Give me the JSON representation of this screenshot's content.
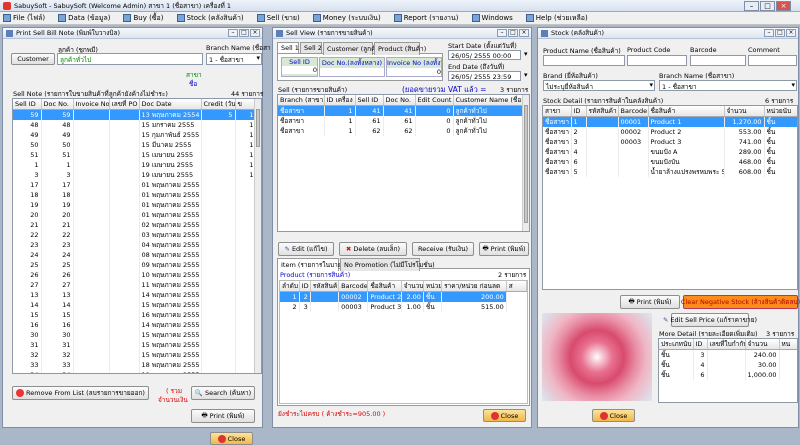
{
  "app": {
    "title": "SabuySoft - SabuySoft (Welcome Admin) สาขา 1 (ชื่อสาขา) เครื่องที่ 1"
  },
  "menu": [
    "File (ไฟล์)",
    "Data (ข้อมูล)",
    "Buy (ซื้อ)",
    "Stock (คลังสินค้า)",
    "Sell (ขาย)",
    "Money (ระบบเงิน)",
    "Report (รายงาน)",
    "Windows",
    "Help (ช่วยเหลือ)"
  ],
  "bill": {
    "title": "Print Sell Bill Note (พิมพ์ใบวางบิล)",
    "customer_code_label": "ลูกค้า (ชูกพมี)",
    "customer_button": "Customer",
    "customer_value": "ลูกค้าทั่วไป",
    "branch_label": "Branch Name (ชื่อสา",
    "branch_value": "1 - ชื่อสาขา",
    "side1": "สาขา",
    "side2": "ชื่อ",
    "list_title": "Sell Note (รายการใบขายสินค้าที่ลูกค้ายังค้างไม่ชำระ)",
    "count": "44 รายการ",
    "cols": [
      "Sell ID",
      "Doc No.",
      "Invoice No.",
      "เลขที่ PO",
      "Doc Date",
      "Credit (วัน)",
      "ข"
    ],
    "rows": [
      [
        "59",
        "59",
        "",
        "",
        "13 พฤษภาคม 2554",
        "5",
        "1"
      ],
      [
        "48",
        "48",
        "",
        "",
        "15 มกราคม 2555",
        "",
        "1"
      ],
      [
        "49",
        "49",
        "",
        "",
        "15 กุมภาพันธ์ 2555",
        "",
        "1"
      ],
      [
        "50",
        "50",
        "",
        "",
        "15 มีนาคม 2555",
        "",
        "1"
      ],
      [
        "51",
        "51",
        "",
        "",
        "15 เมษายน 2555",
        "",
        "1"
      ],
      [
        "1",
        "1",
        "",
        "",
        "19 เมษายน 2555",
        "",
        "1"
      ],
      [
        "3",
        "3",
        "",
        "",
        "19 เมษายน 2555",
        "",
        "1"
      ],
      [
        "17",
        "17",
        "",
        "",
        "01 พฤษภาคม 2555",
        "",
        ""
      ],
      [
        "18",
        "18",
        "",
        "",
        "01 พฤษภาคม 2555",
        "",
        ""
      ],
      [
        "19",
        "19",
        "",
        "",
        "01 พฤษภาคม 2555",
        "",
        ""
      ],
      [
        "20",
        "20",
        "",
        "",
        "01 พฤษภาคม 2555",
        "",
        ""
      ],
      [
        "21",
        "21",
        "",
        "",
        "02 พฤษภาคม 2555",
        "",
        ""
      ],
      [
        "22",
        "22",
        "",
        "",
        "03 พฤษภาคม 2555",
        "",
        ""
      ],
      [
        "23",
        "23",
        "",
        "",
        "04 พฤษภาคม 2555",
        "",
        ""
      ],
      [
        "24",
        "24",
        "",
        "",
        "08 พฤษภาคม 2555",
        "",
        ""
      ],
      [
        "25",
        "25",
        "",
        "",
        "09 พฤษภาคม 2555",
        "",
        ""
      ],
      [
        "26",
        "26",
        "",
        "",
        "10 พฤษภาคม 2555",
        "",
        ""
      ],
      [
        "27",
        "27",
        "",
        "",
        "11 พฤษภาคม 2555",
        "",
        ""
      ],
      [
        "13",
        "13",
        "",
        "",
        "14 พฤษภาคม 2555",
        "",
        ""
      ],
      [
        "14",
        "14",
        "",
        "",
        "15 พฤษภาคม 2555",
        "",
        ""
      ],
      [
        "15",
        "15",
        "",
        "",
        "16 พฤษภาคม 2555",
        "",
        ""
      ],
      [
        "16",
        "16",
        "",
        "",
        "14 พฤษภาคม 2555",
        "",
        ""
      ],
      [
        "30",
        "30",
        "",
        "",
        "15 พฤษภาคม 2555",
        "",
        ""
      ],
      [
        "31",
        "31",
        "",
        "",
        "15 พฤษภาคม 2555",
        "",
        ""
      ],
      [
        "32",
        "32",
        "",
        "",
        "15 พฤษภาคม 2555",
        "",
        ""
      ],
      [
        "33",
        "33",
        "",
        "",
        "18 พฤษภาคม 2555",
        "",
        ""
      ],
      [
        "34",
        "34",
        "",
        "",
        "19 พฤษภาคม 2555",
        "",
        ""
      ]
    ],
    "remove_button": "Remove From List (ลบรายการขายออก)",
    "total_label1": "( รวม",
    "total_label2": "จำนวนเงิน",
    "search_button": "Search (ค้นหา)",
    "print_button": "Print (พิมพ์)",
    "close_button": "Close"
  },
  "sell": {
    "title": "Sell View (รายการขายสินค้า)",
    "tabs": [
      "Sell 1",
      "Sell 2",
      "Customer (ลูกค้า)",
      "Product (สินค้า)"
    ],
    "cols_a": [
      "Sell ID",
      "Doc No.(ลงทั้งหลาง)",
      "Invoice No (ลงทั้งห"
    ],
    "vals_a": [
      "0",
      "",
      "0"
    ],
    "start_label": "Start Date (ตั้งแต่วันที่)",
    "start_value": "26/05/ 2555 00:00",
    "end_label": "End Date (ถึงวันที่)",
    "end_value": "26/05/ 2555 23:59",
    "list_title": "Sell (รายการขายสินค้า)",
    "vat": "(ยอดขายรวม VAT แล้ว =",
    "count": "3 รายการ",
    "cols": [
      "Branch (สาขา)",
      "ID เครื่อง",
      "Sell ID",
      "Doc No.",
      "Edit Count",
      "Customer Name (ชื่อลูกค้"
    ],
    "rows": [
      [
        "ชื่อสาขา",
        "1",
        "41",
        "41",
        "0",
        "ลูกค้าทั่วไป"
      ],
      [
        "ชื่อสาขา",
        "1",
        "61",
        "61",
        "0",
        "ลูกค้าทั่วไป"
      ],
      [
        "ชื่อสาขา",
        "1",
        "62",
        "62",
        "0",
        "ลูกค้าทั่วไป"
      ]
    ],
    "edit_button": "Edit (แก้ไข)",
    "delete_button": "Delete (ลบเล็ก)",
    "receive_button": "Receive (รับเงิน)",
    "print_button": "Print (พิมพ์)",
    "tabs2": [
      "Item (รายการในบาย)",
      "No Promotion (ไม่มีโปรโมชั่น)"
    ],
    "prod_title": "Product (รายการสินค้า)",
    "prod_count": "2 รายการ",
    "prod_cols": [
      "ลำดับ",
      "ID",
      "รหัสสินค้า",
      "Barcode",
      "ชื่อสินค้า",
      "จำนวน",
      "หน่วย",
      "ราคา/หน่วย ก่อนลด",
      "ส"
    ],
    "prod_rows": [
      [
        "1",
        "2",
        "",
        "00002",
        "Product 2",
        "2.00",
        "ชิ้น",
        "200.00"
      ],
      [
        "2",
        "3",
        "",
        "00003",
        "Product 3",
        "1.00",
        "ชิ้น",
        "515.00"
      ]
    ],
    "footer": "ยังชำระไม่ครบ ( ค้างชำระ=905.00 )",
    "close_button": "Close"
  },
  "stock": {
    "title": "Stock (คลังสินค้า)",
    "labels": [
      "Product Name (ชื่อสินค้า)",
      "Product Code",
      "Barcode",
      "Comment"
    ],
    "brand_label": "Brand (ยี่ห้อสินค้า)",
    "brand_value": "ไม่ระบุยี่ห้อสินค้า",
    "branch_label": "Branch Name (ชื่อสาขา)",
    "branch_value": "1 - ชื่อสาขา",
    "list_title": "Stock Detail (รายการสินค้าในคลังสินค้า)",
    "count": "6 รายการ",
    "cols": [
      "สาขา",
      "ID",
      "รหัสสินค้า",
      "Barcode",
      "ชื่อสินค้า",
      "จำนวน",
      "หน่วยนับ"
    ],
    "rows": [
      [
        "ชื่อสาขา",
        "1",
        "",
        "00001",
        "Product 1",
        "1,270.00",
        "ชิ้น"
      ],
      [
        "ชื่อสาขา",
        "2",
        "",
        "00002",
        "Product 2",
        "553.00",
        "ชิ้น"
      ],
      [
        "ชื่อสาขา",
        "3",
        "",
        "00003",
        "Product 3",
        "741.00",
        "ชิ้น"
      ],
      [
        "ชื่อสาขา",
        "4",
        "",
        "",
        "ขนมปัง A",
        "289.00",
        "ชิ้น"
      ],
      [
        "ชื่อสาขา",
        "6",
        "",
        "",
        "ขนมปังบัน",
        "468.00",
        "ชิ้น"
      ],
      [
        "ชื่อสาขา",
        "5",
        "",
        "",
        "น้ำยาล้างแปรงพรหมพระ 500ml",
        "608.00",
        "ชิ้น"
      ]
    ],
    "print_button": "Print (พิมพ์)",
    "clear_button": "Clear Negative Stock (ล้างสินค้าติดลบ)",
    "edit_price_button": "Edit Sell Price (แก้ราคาขาย)",
    "more_title": "More Detail (รายละเอียดเพิ่มเติม)",
    "more_count": "3 รายการ",
    "more_cols": [
      "ประเภทนับ",
      "ID",
      "เลขที่ใบกำกับ",
      "จำนวน",
      "หน"
    ],
    "more_rows": [
      [
        "ชิ้น",
        "3",
        "",
        "240.00",
        ""
      ],
      [
        "ชิ้น",
        "4",
        "",
        "30.00",
        ""
      ],
      [
        "ชิ้น",
        "6",
        "",
        "1,000.00",
        ""
      ]
    ],
    "close_button": "Close"
  },
  "colors": {
    "selection": "#3399ff",
    "clear_btn": "#ff8c1a",
    "close_btn": "#f5c96a"
  }
}
